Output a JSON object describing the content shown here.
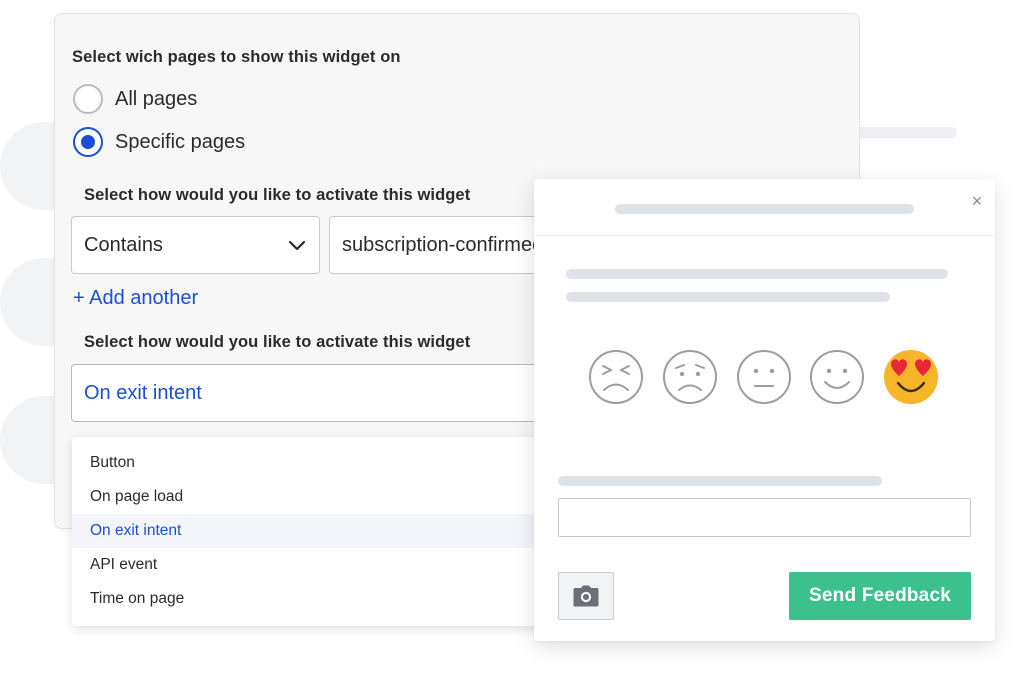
{
  "settings": {
    "pages_heading": "Select wich pages to show this widget on",
    "radio_all_label": "All pages",
    "radio_specific_label": "Specific pages",
    "selected_radio": "specific",
    "activation_heading_1": "Select how would you like to activate this widget",
    "match_select_value": "Contains",
    "match_input_value": "subscription-confirmed",
    "add_another_label": "+ Add another",
    "activation_heading_2": "Select how would you like to activate this widget",
    "trigger_select_value": "On exit intent",
    "trigger_options": [
      "Button",
      "On page load",
      "On exit intent",
      "API event",
      "Time on page"
    ],
    "trigger_selected_index": 2
  },
  "widget": {
    "close_label": "×",
    "emojis": [
      "angry-face-icon",
      "sad-face-icon",
      "neutral-face-icon",
      "smiling-face-icon",
      "heart-eyes-face-icon"
    ],
    "selected_emoji": "heart-eyes-face-icon",
    "feedback_input_value": "",
    "camera_icon": "camera-icon",
    "send_label": "Send Feedback"
  },
  "colors": {
    "accent": "#1a4fd6",
    "send_button": "#3cc08e",
    "emoji_outline": "#9a9da3",
    "emoji_selected_fill": "#f7b52a",
    "heart": "#e8263a"
  }
}
